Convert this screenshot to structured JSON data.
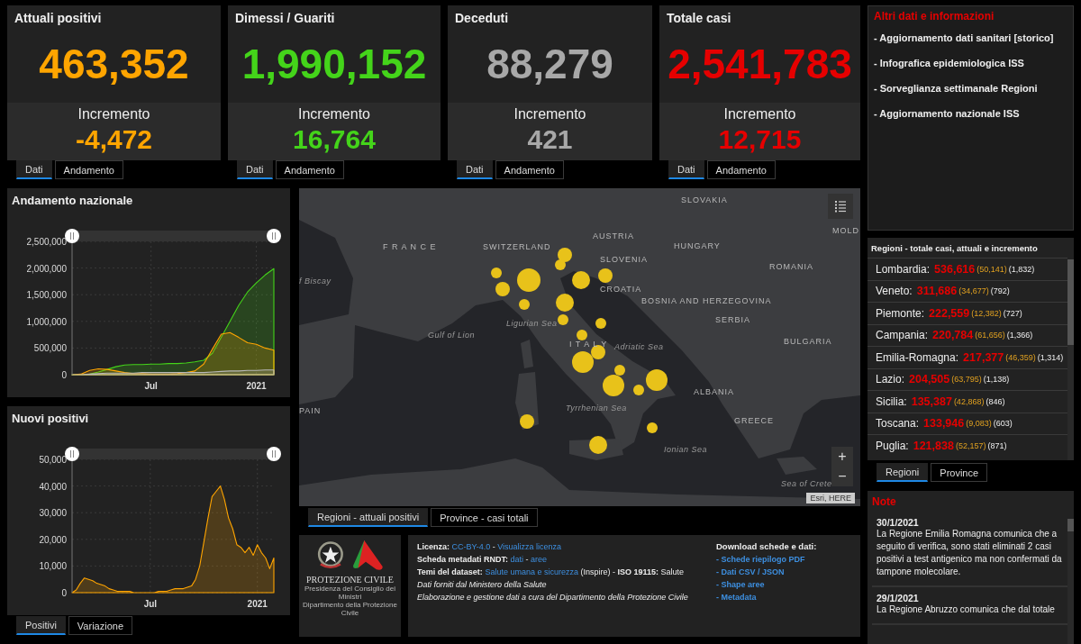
{
  "stat_cards": [
    {
      "title": "Attuali positivi",
      "value": "463,352",
      "increment_label": "Incremento",
      "increment": "-4,472",
      "color": "#ffa500",
      "tabs": [
        {
          "label": "Dati",
          "selected": true
        },
        {
          "label": "Andamento",
          "selected": false
        }
      ]
    },
    {
      "title": "Dimessi / Guariti",
      "value": "1,990,152",
      "increment_label": "Incremento",
      "increment": "16,764",
      "color": "#44d41a",
      "tabs": [
        {
          "label": "Dati",
          "selected": true
        },
        {
          "label": "Andamento",
          "selected": false
        }
      ]
    },
    {
      "title": "Deceduti",
      "value": "88,279",
      "increment_label": "Incremento",
      "increment": "421",
      "color": "#a8a8a8",
      "tabs": [
        {
          "label": "Dati",
          "selected": true
        },
        {
          "label": "Andamento",
          "selected": false
        }
      ]
    },
    {
      "title": "Totale casi",
      "value": "2,541,783",
      "increment_label": "Incremento",
      "increment": "12,715",
      "color": "#e60000",
      "tabs": [
        {
          "label": "Dati",
          "selected": true
        },
        {
          "label": "Andamento",
          "selected": false
        }
      ]
    }
  ],
  "left_charts": [
    {
      "title": "Andamento nazionale",
      "chart_data": {
        "type": "area",
        "grid": true,
        "categories": [
          null,
          null,
          null,
          null,
          null,
          null,
          null,
          null,
          null,
          "Jul",
          null,
          null,
          null,
          null,
          null,
          null,
          null,
          null,
          null,
          null,
          null,
          "2021",
          null,
          null
        ],
        "ylim": [
          0,
          2500000
        ],
        "yticks": [
          {
            "value": 0,
            "label": "0"
          },
          {
            "value": 500000,
            "label": "500,000"
          },
          {
            "value": 1000000,
            "label": "1,000,000"
          },
          {
            "value": 1500000,
            "label": "1,500,000"
          },
          {
            "value": 2000000,
            "label": "2,000,000"
          },
          {
            "value": 2500000,
            "label": "2,500,000"
          }
        ],
        "series": [
          {
            "color": "#44d41a",
            "values": [
              0,
              0,
              10000,
              50000,
              100000,
              150000,
              180000,
              190000,
              190000,
              200000,
              200000,
              210000,
              210000,
              220000,
              240000,
              270000,
              400000,
              700000,
              1000000,
              1300000,
              1550000,
              1720000,
              1870000,
              1990000
            ]
          },
          {
            "color": "#ffa500",
            "values": [
              0,
              10000,
              80000,
              110000,
              100000,
              70000,
              40000,
              20000,
              20000,
              10000,
              10000,
              10000,
              20000,
              40000,
              70000,
              200000,
              480000,
              760000,
              790000,
              700000,
              600000,
              570000,
              500000,
              460000
            ]
          },
          {
            "color": "#b8b8b8",
            "values": [
              0,
              0,
              10000,
              20000,
              30000,
              30000,
              30000,
              30000,
              40000,
              40000,
              40000,
              40000,
              40000,
              40000,
              40000,
              40000,
              50000,
              60000,
              70000,
              70000,
              80000,
              80000,
              90000,
              90000
            ]
          }
        ]
      }
    },
    {
      "title": "Nuovi positivi",
      "chart_data": {
        "type": "area",
        "grid": true,
        "categories": [
          null,
          null,
          null,
          null,
          null,
          null,
          null,
          null,
          null,
          null,
          null,
          null,
          null,
          null,
          null,
          null,
          null,
          null,
          null,
          "Jul",
          null,
          null,
          null,
          null,
          null,
          null,
          null,
          null,
          null,
          null,
          null,
          null,
          null,
          null,
          null,
          null,
          null,
          null,
          null,
          null,
          null,
          null,
          null,
          null,
          null,
          "2021",
          null,
          null,
          null,
          null
        ],
        "ylim": [
          0,
          50000
        ],
        "yticks": [
          {
            "value": 0,
            "label": "0"
          },
          {
            "value": 10000,
            "label": "10,000"
          },
          {
            "value": 20000,
            "label": "20,000"
          },
          {
            "value": 30000,
            "label": "30,000"
          },
          {
            "value": 40000,
            "label": "40,000"
          },
          {
            "value": 50000,
            "label": "50,000"
          }
        ],
        "series": [
          {
            "color": "#ffa500",
            "values": [
              0,
              1000,
              3500,
              5500,
              5000,
              4500,
              3500,
              3000,
              2500,
              1500,
              1000,
              500,
              500,
              500,
              500,
              0,
              0,
              0,
              0,
              0,
              0,
              500,
              500,
              500,
              1000,
              1500,
              1500,
              1500,
              2000,
              2500,
              5000,
              10000,
              19000,
              28000,
              36000,
              38000,
              40000,
              35000,
              28000,
              24000,
              18000,
              17000,
              15000,
              17000,
              14000,
              18000,
              15000,
              13000,
              9000,
              13000
            ]
          }
        ]
      }
    }
  ],
  "left_tabs": [
    {
      "label": "Positivi",
      "selected": true
    },
    {
      "label": "Variazione",
      "selected": false
    }
  ],
  "map": {
    "labels": [
      {
        "text": "SLOVAKIA",
        "kind": "country"
      },
      {
        "text": "MOLD",
        "kind": "country"
      },
      {
        "text": "AUSTRIA",
        "kind": "country"
      },
      {
        "text": "F R A N C E",
        "kind": "country"
      },
      {
        "text": "SWITZERLAND",
        "kind": "country"
      },
      {
        "text": "HUNGARY",
        "kind": "country"
      },
      {
        "text": "SLOVENIA",
        "kind": "country"
      },
      {
        "text": "ROMANIA",
        "kind": "country"
      },
      {
        "text": "f Biscay",
        "kind": "sea"
      },
      {
        "text": "CROATIA",
        "kind": "country"
      },
      {
        "text": "BOSNIA AND HERZEGOVINA",
        "kind": "country"
      },
      {
        "text": "Ligurian Sea",
        "kind": "sea"
      },
      {
        "text": "SERBIA",
        "kind": "country"
      },
      {
        "text": "Gulf of Lion",
        "kind": "sea"
      },
      {
        "text": "I T A L Y",
        "kind": "country"
      },
      {
        "text": "Adriatic Sea",
        "kind": "sea"
      },
      {
        "text": "BULGARIA",
        "kind": "country"
      },
      {
        "text": "PAIN",
        "kind": "country"
      },
      {
        "text": "Tyrrhenian Sea",
        "kind": "sea"
      },
      {
        "text": "ALBANIA",
        "kind": "country"
      },
      {
        "text": "GREECE",
        "kind": "country"
      },
      {
        "text": "Ionian Sea",
        "kind": "sea"
      },
      {
        "text": "Sea of Crete",
        "kind": "sea"
      }
    ],
    "zoom_in": "+",
    "zoom_out": "−",
    "attribution": "Esri, HERE",
    "tabs": [
      {
        "label": "Regioni - attuali positivi",
        "selected": true
      },
      {
        "label": "Province - casi totali",
        "selected": false
      }
    ]
  },
  "logo": {
    "name": "PROTEZIONE CIVILE",
    "line_1": "Presidenza del Consiglio dei Ministri",
    "line_2": "Dipartimento della Protezione Civile"
  },
  "info": {
    "lines": [
      {
        "segments": [
          {
            "kind": "label",
            "text": "Licenza:"
          },
          {
            "kind": "link",
            "text": "CC-BY-4.0"
          },
          {
            "kind": "plain",
            "text": "-"
          },
          {
            "kind": "link",
            "text": "Visualizza licenza"
          }
        ]
      },
      {
        "segments": [
          {
            "kind": "label",
            "text": "Scheda metadati RNDT:"
          },
          {
            "kind": "link",
            "text": "dati"
          },
          {
            "kind": "plain",
            "text": "-"
          },
          {
            "kind": "link",
            "text": "aree"
          }
        ]
      },
      {
        "segments": [
          {
            "kind": "label",
            "text": "Temi del dataset:"
          },
          {
            "kind": "link",
            "text": "Salute umana e sicurezza"
          },
          {
            "kind": "plain",
            "text": "(Inspire) -"
          },
          {
            "kind": "label",
            "text": "ISO 19115:"
          },
          {
            "kind": "plain",
            "text": "Salute"
          }
        ]
      },
      {
        "segments": [
          {
            "kind": "italic",
            "text": "Dati forniti dal Ministero della Salute"
          }
        ]
      },
      {
        "segments": [
          {
            "kind": "italic",
            "text": "Elaborazione e gestione dati a cura del Dipartimento della Protezione Civile"
          }
        ]
      }
    ],
    "download_title": "Download schede e dati:",
    "downloads": [
      "- Schede riepilogo PDF",
      "- Dati CSV / JSON",
      "- Shape aree",
      "- Metadata"
    ]
  },
  "other_info": {
    "title": "Altri dati e informazioni",
    "links": [
      "- Aggiornamento dati sanitari [storico]",
      "- Infografica epidemiologica ISS",
      "- Sorveglianza settimanale Regioni",
      "- Aggiornamento nazionale ISS"
    ]
  },
  "regions": {
    "title": "Regioni - totale casi, attuali e incremento",
    "rows": [
      {
        "name": "Lombardia:",
        "total": "536,616",
        "current": "(50,141)",
        "increment": "(1,832)"
      },
      {
        "name": "Veneto:",
        "total": "311,686",
        "current": "(34,677)",
        "increment": "(792)"
      },
      {
        "name": "Piemonte:",
        "total": "222,559",
        "current": "(12,382)",
        "increment": "(727)"
      },
      {
        "name": "Campania:",
        "total": "220,784",
        "current": "(61,656)",
        "increment": "(1,366)"
      },
      {
        "name": "Emilia-Romagna:",
        "total": "217,377",
        "current": "(46,359)",
        "increment": "(1,314)"
      },
      {
        "name": "Lazio:",
        "total": "204,505",
        "current": "(63,795)",
        "increment": "(1,138)"
      },
      {
        "name": "Sicilia:",
        "total": "135,387",
        "current": "(42,868)",
        "increment": "(846)"
      },
      {
        "name": "Toscana:",
        "total": "133,946",
        "current": "(9,083)",
        "increment": "(603)"
      },
      {
        "name": "Puglia:",
        "total": "121,838",
        "current": "(52,157)",
        "increment": "(871)"
      }
    ],
    "tabs": [
      {
        "label": "Regioni",
        "selected": true
      },
      {
        "label": "Province",
        "selected": false
      }
    ]
  },
  "notes": {
    "title": "Note",
    "items": [
      {
        "date": "30/1/2021",
        "text": "La Regione Emilia Romagna comunica che a seguito di verifica, sono stati eliminati 2 casi positivi a test antigenico ma non confermati da tampone molecolare."
      },
      {
        "date": "29/1/2021",
        "text": "La Regione Abruzzo comunica che dal totale"
      }
    ]
  }
}
